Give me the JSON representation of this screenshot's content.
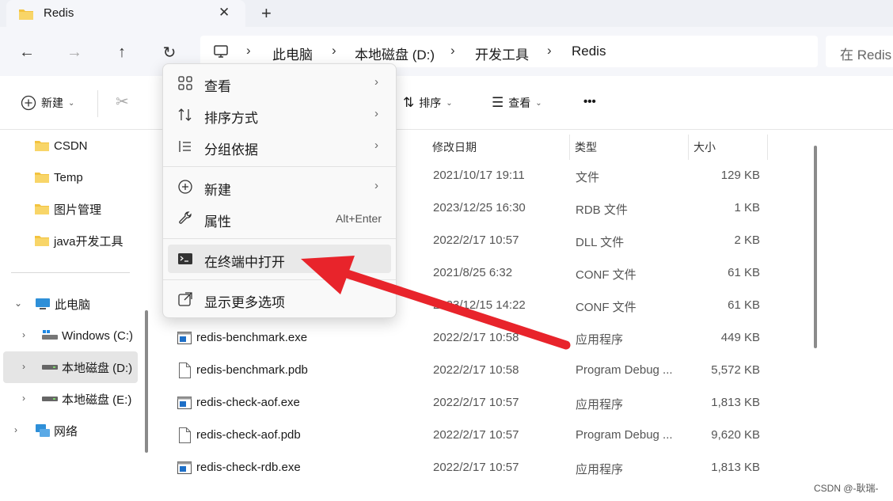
{
  "tab": {
    "title": "Redis",
    "close_icon": "close-icon",
    "new_tab": "+"
  },
  "breadcrumb": [
    "此电脑",
    "本地磁盘 (D:)",
    "开发工具",
    "Redis"
  ],
  "search": {
    "placeholder": "在 Redis"
  },
  "toolbar": {
    "new_label": "新建",
    "sort_label": "排序",
    "view_label": "查看",
    "more_label": "•••"
  },
  "sidebar": {
    "folders": [
      "CSDN",
      "Temp",
      "图片管理",
      "java开发工具"
    ],
    "this_pc": "此电脑",
    "drives": [
      "Windows (C:)",
      "本地磁盘 (D:)",
      "本地磁盘 (E:)"
    ],
    "network": "网络"
  },
  "columns": {
    "modified": "修改日期",
    "type": "类型",
    "size": "大小"
  },
  "files": [
    {
      "name": "",
      "modified": "2021/10/17 19:11",
      "type": "文件",
      "size": "129 KB"
    },
    {
      "name": "",
      "modified": "2023/12/25 16:30",
      "type": "RDB 文件",
      "size": "1 KB"
    },
    {
      "name": "",
      "modified": "2022/2/17 10:57",
      "type": "DLL 文件",
      "size": "2 KB"
    },
    {
      "name": "",
      "modified": "2021/8/25 6:32",
      "type": "CONF 文件",
      "size": "61 KB"
    },
    {
      "name": "",
      "modified": "2023/12/15 14:22",
      "type": "CONF 文件",
      "size": "61 KB"
    },
    {
      "name": "redis-benchmark.exe",
      "modified": "2022/2/17 10:58",
      "type": "应用程序",
      "size": "449 KB"
    },
    {
      "name": "redis-benchmark.pdb",
      "modified": "2022/2/17 10:58",
      "type": "Program Debug ...",
      "size": "5,572 KB"
    },
    {
      "name": "redis-check-aof.exe",
      "modified": "2022/2/17 10:57",
      "type": "应用程序",
      "size": "1,813 KB"
    },
    {
      "name": "redis-check-aof.pdb",
      "modified": "2022/2/17 10:57",
      "type": "Program Debug ...",
      "size": "9,620 KB"
    },
    {
      "name": "redis-check-rdb.exe",
      "modified": "2022/2/17 10:57",
      "type": "应用程序",
      "size": "1,813 KB"
    }
  ],
  "context_menu": {
    "view": "查看",
    "sort_by": "排序方式",
    "group_by": "分组依据",
    "new": "新建",
    "properties": "属性",
    "properties_shortcut": "Alt+Enter",
    "open_in_terminal": "在终端中打开",
    "show_more": "显示更多选项"
  },
  "watermark": "CSDN @-耿瑞-",
  "colors": {
    "accent_arrow": "#e8242b",
    "folder": "#f3c33f",
    "exe_blue": "#1e6fc7"
  }
}
